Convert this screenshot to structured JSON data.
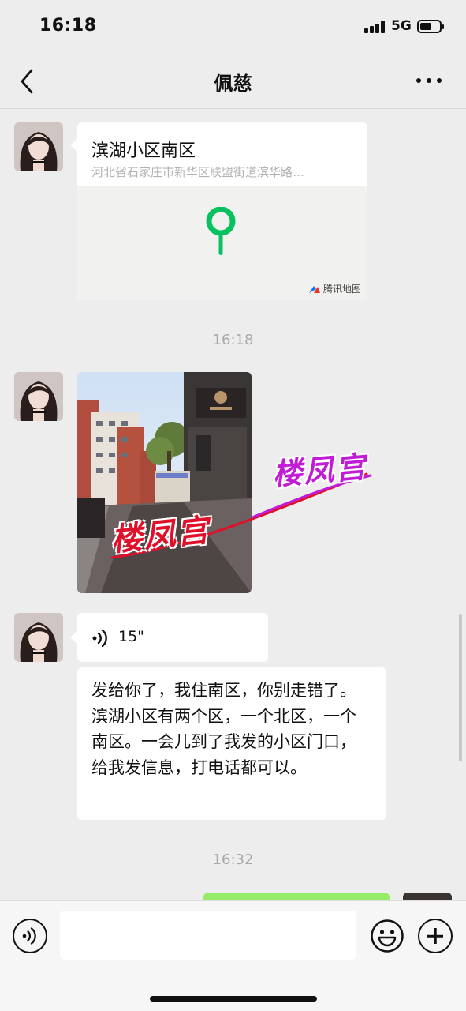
{
  "status_bar": {
    "time": "16:18",
    "network": "5G",
    "battery_level": 0.6
  },
  "nav": {
    "title": "佩慈"
  },
  "messages": {
    "location": {
      "name": "滨湖小区南区",
      "address": "河北省石家庄市新华区联盟街道滨华路…",
      "map_brand": "腾讯地图"
    },
    "timestamp_1": "16:18",
    "voice": {
      "duration": "15\""
    },
    "text": "发给你了，我住南区，你别走错了。滨湖小区有两个区，一个北区，一个南区。一会儿到了我发的小区门口，给我发信息，打电话都可以。",
    "timestamp_2": "16:32"
  },
  "watermark": {
    "text_1": "楼凤宫",
    "text_2": "楼凤宫"
  },
  "colors": {
    "accent_green": "#07c160",
    "outgoing_bubble": "#95ec69",
    "watermark_red": "#e0102a",
    "watermark_magenta": "#c21bd8"
  },
  "icons": [
    "back-chevron-icon",
    "more-dots-icon",
    "map-pin-icon",
    "tencent-map-logo",
    "voice-wave-icon",
    "voice-toggle-icon",
    "emoji-icon",
    "plus-icon"
  ]
}
